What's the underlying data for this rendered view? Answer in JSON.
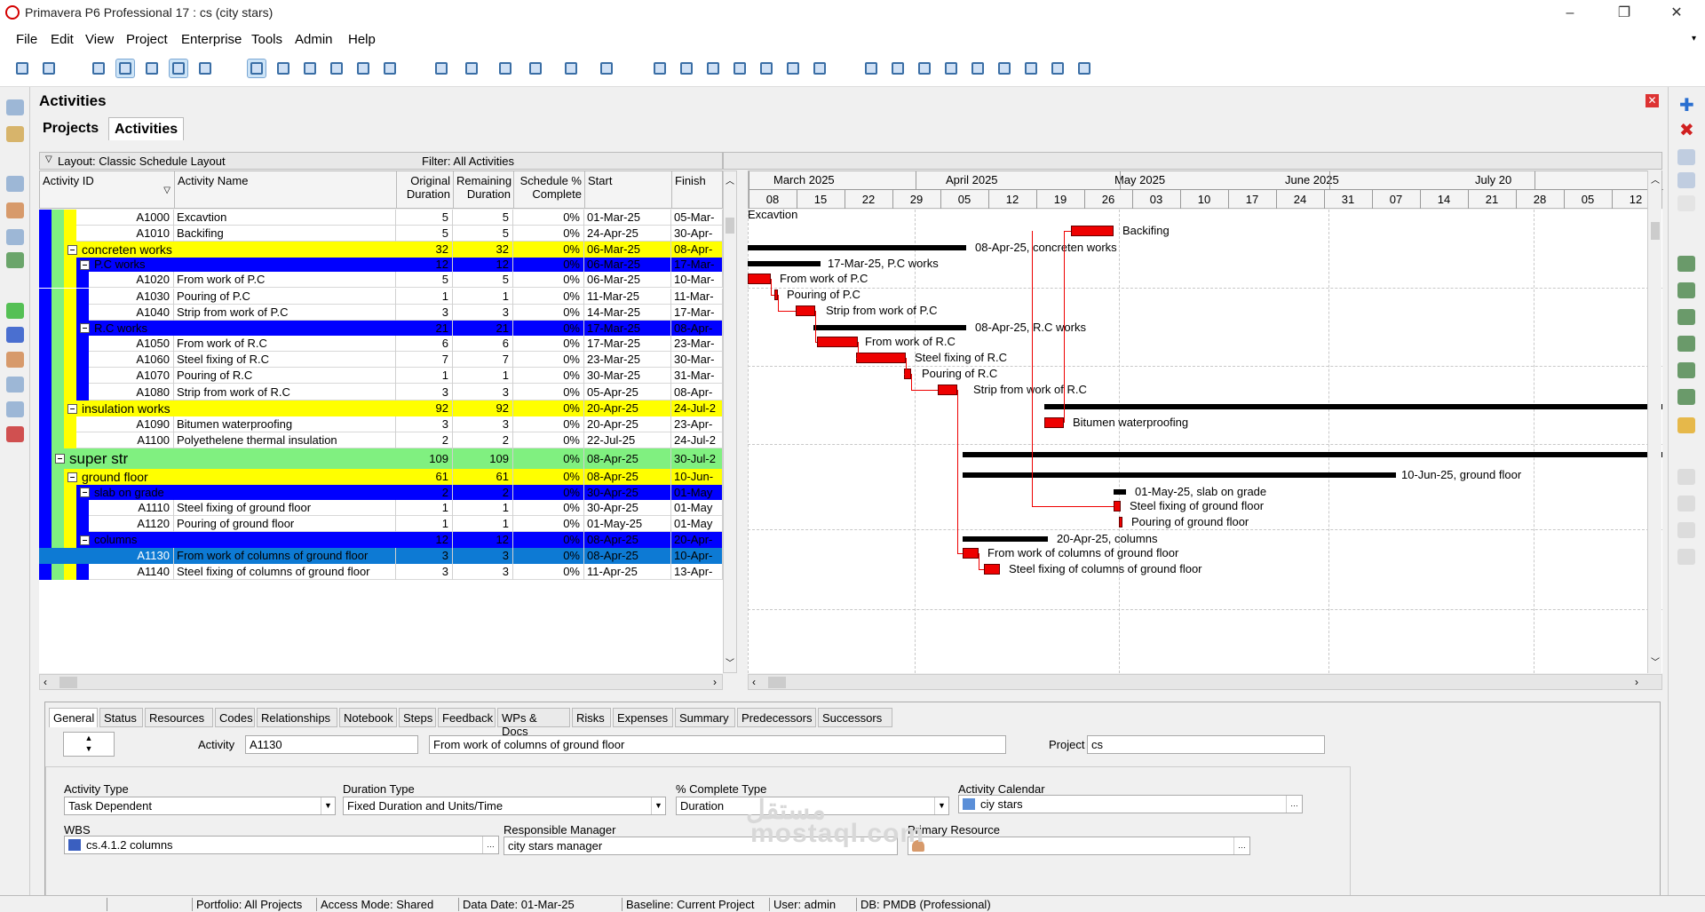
{
  "window": {
    "title": "Primavera P6 Professional 17 : cs (city stars)"
  },
  "menu": [
    "File",
    "Edit",
    "View",
    "Project",
    "Enterprise",
    "Tools",
    "Admin",
    "Help"
  ],
  "pane": {
    "title": "Activities",
    "tab_projects": "Projects",
    "tab_activities": "Activities"
  },
  "grid": {
    "layout": "Layout: Classic Schedule Layout",
    "filter": "Filter: All Activities",
    "headers": {
      "id": "Activity ID",
      "name": "Activity Name",
      "orig1": "Original",
      "orig2": "Duration",
      "rem1": "Remaining",
      "rem2": "Duration",
      "sch1": "Schedule %",
      "sch2": "Complete",
      "start": "Start",
      "finish": "Finish"
    }
  },
  "rows": [
    {
      "id": "A1000",
      "name": "Excavtion",
      "od": "5",
      "rd": "5",
      "pct": "0%",
      "start": "01-Mar-25",
      "finish": "05-Mar-"
    },
    {
      "id": "A1010",
      "name": "Backifing",
      "od": "5",
      "rd": "5",
      "pct": "0%",
      "start": "24-Apr-25",
      "finish": "30-Apr-"
    },
    {
      "name": "concreten works",
      "od": "32",
      "rd": "32",
      "pct": "0%",
      "start": "06-Mar-25",
      "finish": "08-Apr-"
    },
    {
      "name": "P.C works",
      "od": "12",
      "rd": "12",
      "pct": "0%",
      "start": "06-Mar-25",
      "finish": "17-Mar-"
    },
    {
      "id": "A1020",
      "name": "From work of P.C",
      "od": "5",
      "rd": "5",
      "pct": "0%",
      "start": "06-Mar-25",
      "finish": "10-Mar-"
    },
    {
      "id": "A1030",
      "name": "Pouring of P.C",
      "od": "1",
      "rd": "1",
      "pct": "0%",
      "start": "11-Mar-25",
      "finish": "11-Mar-"
    },
    {
      "id": "A1040",
      "name": "Strip from work of P.C",
      "od": "3",
      "rd": "3",
      "pct": "0%",
      "start": "14-Mar-25",
      "finish": "17-Mar-"
    },
    {
      "name": "R.C works",
      "od": "21",
      "rd": "21",
      "pct": "0%",
      "start": "17-Mar-25",
      "finish": "08-Apr-"
    },
    {
      "id": "A1050",
      "name": "From work of R.C",
      "od": "6",
      "rd": "6",
      "pct": "0%",
      "start": "17-Mar-25",
      "finish": "23-Mar-"
    },
    {
      "id": "A1060",
      "name": "Steel fixing of R.C",
      "od": "7",
      "rd": "7",
      "pct": "0%",
      "start": "23-Mar-25",
      "finish": "30-Mar-"
    },
    {
      "id": "A1070",
      "name": "Pouring of R.C",
      "od": "1",
      "rd": "1",
      "pct": "0%",
      "start": "30-Mar-25",
      "finish": "31-Mar-"
    },
    {
      "id": "A1080",
      "name": "Strip from work of R.C",
      "od": "3",
      "rd": "3",
      "pct": "0%",
      "start": "05-Apr-25",
      "finish": "08-Apr-"
    },
    {
      "name": "insulation works",
      "od": "92",
      "rd": "92",
      "pct": "0%",
      "start": "20-Apr-25",
      "finish": "24-Jul-2"
    },
    {
      "id": "A1090",
      "name": "Bitumen waterproofing",
      "od": "3",
      "rd": "3",
      "pct": "0%",
      "start": "20-Apr-25",
      "finish": "23-Apr-"
    },
    {
      "id": "A1100",
      "name": "Polyethelene thermal insulation",
      "od": "2",
      "rd": "2",
      "pct": "0%",
      "start": "22-Jul-25",
      "finish": "24-Jul-2"
    },
    {
      "name": "super str",
      "od": "109",
      "rd": "109",
      "pct": "0%",
      "start": "08-Apr-25",
      "finish": "30-Jul-2"
    },
    {
      "name": "ground floor",
      "od": "61",
      "rd": "61",
      "pct": "0%",
      "start": "08-Apr-25",
      "finish": "10-Jun-"
    },
    {
      "name": "slab on grade",
      "od": "2",
      "rd": "2",
      "pct": "0%",
      "start": "30-Apr-25",
      "finish": "01-May"
    },
    {
      "id": "A1110",
      "name": "Steel fixing of ground floor",
      "od": "1",
      "rd": "1",
      "pct": "0%",
      "start": "30-Apr-25",
      "finish": "01-May"
    },
    {
      "id": "A1120",
      "name": "Pouring of ground floor",
      "od": "1",
      "rd": "1",
      "pct": "0%",
      "start": "01-May-25",
      "finish": "01-May"
    },
    {
      "name": "columns",
      "od": "12",
      "rd": "12",
      "pct": "0%",
      "start": "08-Apr-25",
      "finish": "20-Apr-"
    },
    {
      "id": "A1130",
      "name": "From work of columns of ground floor",
      "od": "3",
      "rd": "3",
      "pct": "0%",
      "start": "08-Apr-25",
      "finish": "10-Apr-"
    },
    {
      "id": "A1140",
      "name": "Steel fixing of columns of ground floor",
      "od": "3",
      "rd": "3",
      "pct": "0%",
      "start": "11-Apr-25",
      "finish": "13-Apr-"
    }
  ],
  "gantt": {
    "months": [
      "March 2025",
      "April 2025",
      "May 2025",
      "June 2025",
      "July 20"
    ],
    "weeks": [
      "08",
      "15",
      "22",
      "29",
      "05",
      "12",
      "19",
      "26",
      "03",
      "10",
      "17",
      "24",
      "31",
      "07",
      "14",
      "21",
      "28",
      "05",
      "12"
    ],
    "labels": [
      "Excavtion",
      "Backifing",
      "08-Apr-25, concreten works",
      "17-Mar-25, P.C works",
      "From work of P.C",
      "Pouring of P.C",
      "Strip from work of P.C",
      "08-Apr-25, R.C works",
      "From work of R.C",
      "Steel fixing of R.C",
      "Pouring of R.C",
      "Strip from work of R.C",
      "Bitumen waterproofing",
      "10-Jun-25, ground floor",
      "01-May-25, slab on grade",
      "Steel fixing of ground floor",
      "Pouring of ground floor",
      "20-Apr-25, columns",
      "From work of columns of ground floor",
      "Steel fixing of columns of ground floor"
    ]
  },
  "detail": {
    "tabs": [
      "General",
      "Status",
      "Resources",
      "Codes",
      "Relationships",
      "Notebook",
      "Steps",
      "Feedback",
      "WPs & Docs",
      "Risks",
      "Expenses",
      "Summary",
      "Predecessors",
      "Successors"
    ],
    "activity_label": "Activity",
    "activity_id": "A1130",
    "activity_name": "From work of columns of ground floor",
    "project_label": "Project",
    "project": "cs",
    "activity_type_label": "Activity Type",
    "activity_type": "Task Dependent",
    "duration_type_label": "Duration Type",
    "duration_type": "Fixed Duration and Units/Time",
    "pct_type_label": "% Complete Type",
    "pct_type": "Duration",
    "calendar_label": "Activity Calendar",
    "calendar": "ciy stars",
    "wbs_label": "WBS",
    "wbs": "cs.4.1.2  columns",
    "manager_label": "Responsible Manager",
    "manager": "city stars manager",
    "resource_label": "Primary Resource",
    "resource": ""
  },
  "watermark": {
    "arabic": "مستقل",
    "latin": "mostaql.com"
  },
  "status": {
    "portfolio": "Portfolio: All Projects",
    "access": "Access Mode: Shared",
    "data_date": "Data Date: 01-Mar-25",
    "baseline": "Baseline: Current Project",
    "user": "User: admin",
    "db": "DB: PMDB (Professional)"
  },
  "colors": {
    "wbs_l1": "#80f080",
    "wbs_l2": "#ffff00",
    "wbs_l3": "#0000ff",
    "selected": "#0d7ad4",
    "bar": "#ee0000"
  }
}
